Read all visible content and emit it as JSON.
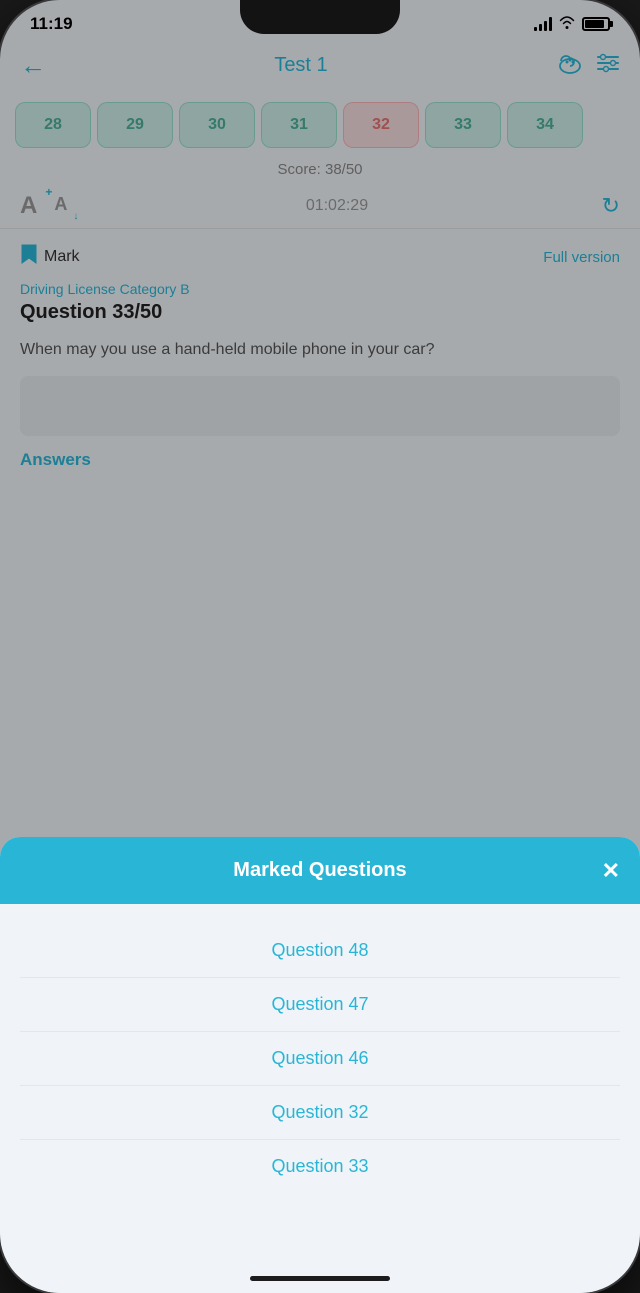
{
  "status": {
    "time": "11:19",
    "battery_icon": "🔋"
  },
  "header": {
    "title": "Test 1",
    "back_label": "←",
    "cloud_icon": "☁",
    "filter_icon": "⊟"
  },
  "question_numbers": [
    {
      "number": "28",
      "state": "green"
    },
    {
      "number": "29",
      "state": "green"
    },
    {
      "number": "30",
      "state": "green"
    },
    {
      "number": "31",
      "state": "green"
    },
    {
      "number": "32",
      "state": "red"
    },
    {
      "number": "33",
      "state": "green"
    },
    {
      "number": "34",
      "state": "green"
    }
  ],
  "score": {
    "label": "Score: 38/50"
  },
  "controls": {
    "font_up": "A",
    "font_down": "A",
    "timer": "01:02:29",
    "refresh": "↻"
  },
  "question": {
    "mark_label": "Mark",
    "full_version_label": "Full version",
    "category": "Driving License Category B",
    "title": "Question 33/50",
    "text": "When may you use a hand-held mobile phone in your car?"
  },
  "answers": {
    "label": "Answers"
  },
  "modal": {
    "title": "Marked Questions",
    "close_label": "✕",
    "items": [
      {
        "label": "Question 48"
      },
      {
        "label": "Question 47"
      },
      {
        "label": "Question 46"
      },
      {
        "label": "Question 32"
      },
      {
        "label": "Question 33"
      }
    ]
  }
}
